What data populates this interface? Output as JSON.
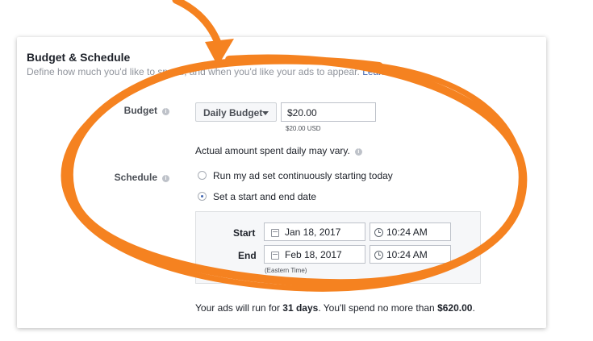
{
  "section": {
    "title": "Budget & Schedule",
    "subtitle": "Define how much you'd like to spend, and when you'd like your ads to appear.",
    "learn_more": "Learn More."
  },
  "budget": {
    "label": "Budget",
    "type_dropdown": "Daily Budget",
    "amount": "$20.00",
    "amount_note": "$20.00 USD",
    "hint": "Actual amount spent daily may vary."
  },
  "schedule": {
    "label": "Schedule",
    "options": [
      "Run my ad set continuously starting today",
      "Set a start and end date"
    ],
    "selected_index": 1,
    "start_label": "Start",
    "start_date": "Jan 18, 2017",
    "start_time": "10:24 AM",
    "end_label": "End",
    "end_date": "Feb 18, 2017",
    "end_time": "10:24 AM",
    "timezone": "(Eastern Time)"
  },
  "summary": {
    "prefix": "Your ads will run for ",
    "days": "31 days",
    "middle": ". You'll spend no more than ",
    "amount": "$620.00",
    "suffix": "."
  },
  "annotation_color": "#f58220"
}
